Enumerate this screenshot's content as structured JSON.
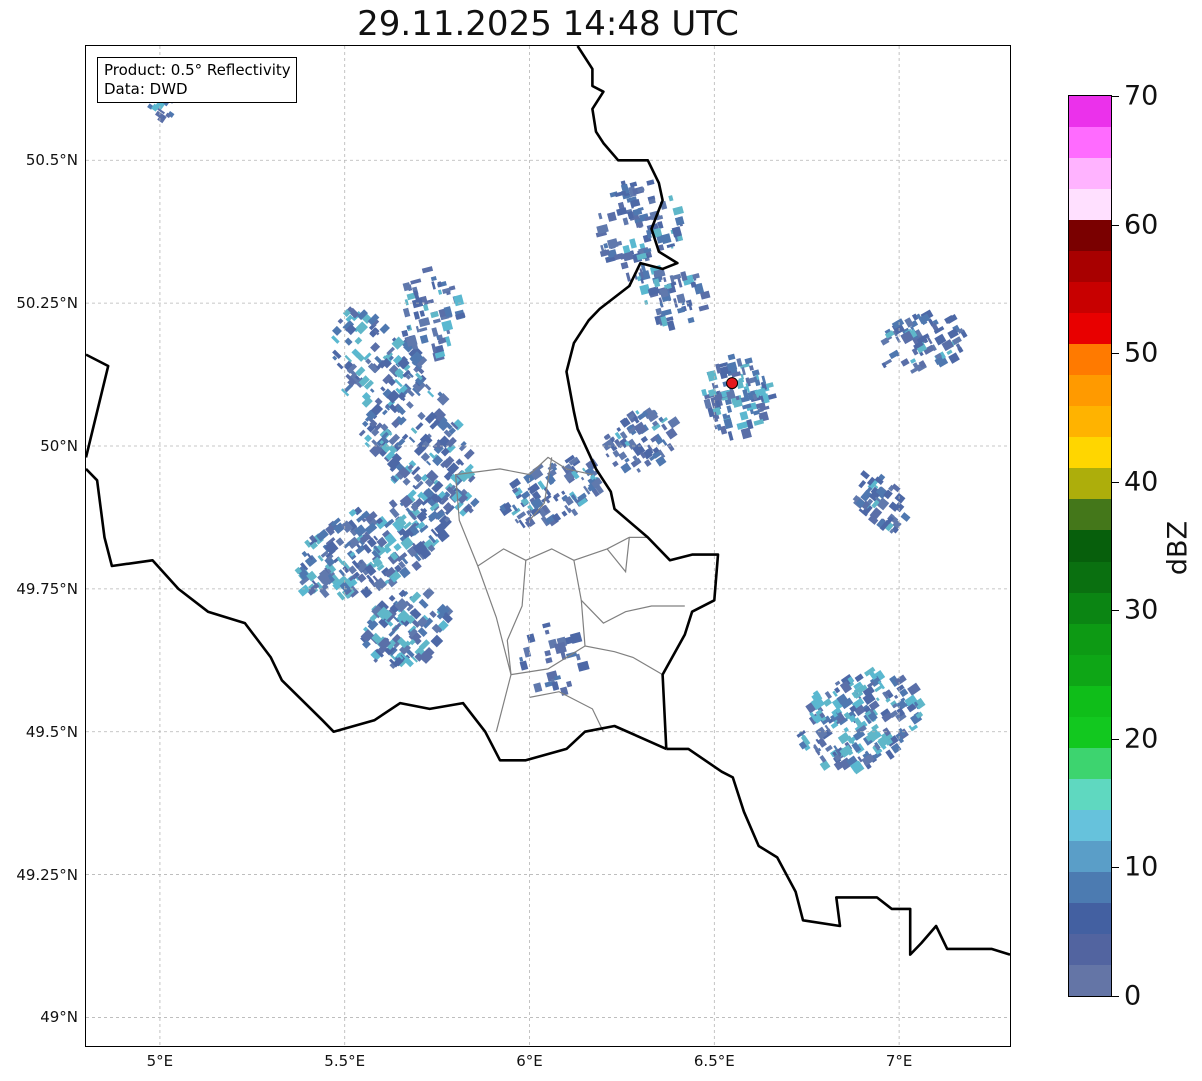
{
  "title": "29.11.2025 14:48 UTC",
  "info": {
    "line1": "Product: 0.5° Reflectivity",
    "line2": "Data: DWD"
  },
  "map": {
    "lon_range": [
      4.8,
      7.3
    ],
    "lat_range": [
      48.95,
      50.7
    ],
    "x_ticks": [
      {
        "value": 5.0,
        "label": "5°E"
      },
      {
        "value": 5.5,
        "label": "5.5°E"
      },
      {
        "value": 6.0,
        "label": "6°E"
      },
      {
        "value": 6.5,
        "label": "6.5°E"
      },
      {
        "value": 7.0,
        "label": "7°E"
      }
    ],
    "y_ticks": [
      {
        "value": 50.5,
        "label": "50.5°N"
      },
      {
        "value": 50.25,
        "label": "50.25°N"
      },
      {
        "value": 50.0,
        "label": "50°N"
      },
      {
        "value": 49.75,
        "label": "49.75°N"
      },
      {
        "value": 49.5,
        "label": "49.5°N"
      },
      {
        "value": 49.25,
        "label": "49.25°N"
      },
      {
        "value": 49.0,
        "label": "49°N"
      }
    ],
    "grid": true,
    "radar_site": {
      "lon": 6.548,
      "lat": 50.11,
      "color": "#e31a1c"
    },
    "precip_areas": [
      {
        "lon": 5.65,
        "lat": 50.05,
        "rlon": 0.12,
        "rlat": 0.21,
        "rot": -30,
        "n": 260,
        "intensity": 0.25
      },
      {
        "lon": 5.55,
        "lat": 49.82,
        "rlon": 0.22,
        "rlat": 0.07,
        "rot": -25,
        "n": 200,
        "intensity": 0.3
      },
      {
        "lon": 5.65,
        "lat": 49.68,
        "rlon": 0.12,
        "rlat": 0.06,
        "rot": -30,
        "n": 110,
        "intensity": 0.25
      },
      {
        "lon": 5.72,
        "lat": 50.24,
        "rlon": 0.08,
        "rlat": 0.08,
        "rot": 0,
        "n": 60,
        "intensity": 0.1
      },
      {
        "lon": 6.05,
        "lat": 49.92,
        "rlon": 0.14,
        "rlat": 0.05,
        "rot": -20,
        "n": 90,
        "intensity": 0.15
      },
      {
        "lon": 6.29,
        "lat": 50.38,
        "rlon": 0.12,
        "rlat": 0.09,
        "rot": 0,
        "n": 90,
        "intensity": 0.1
      },
      {
        "lon": 6.38,
        "lat": 50.26,
        "rlon": 0.09,
        "rlat": 0.05,
        "rot": 0,
        "n": 45,
        "intensity": 0.1
      },
      {
        "lon": 6.55,
        "lat": 50.09,
        "rlon": 0.09,
        "rlat": 0.07,
        "rot": 0,
        "n": 90,
        "intensity": 0.3
      },
      {
        "lon": 6.29,
        "lat": 50.01,
        "rlon": 0.1,
        "rlat": 0.05,
        "rot": -20,
        "n": 65,
        "intensity": 0.1
      },
      {
        "lon": 7.05,
        "lat": 50.18,
        "rlon": 0.12,
        "rlat": 0.05,
        "rot": -15,
        "n": 70,
        "intensity": 0.1
      },
      {
        "lon": 6.94,
        "lat": 49.9,
        "rlon": 0.06,
        "rlat": 0.06,
        "rot": -35,
        "n": 45,
        "intensity": 0.15
      },
      {
        "lon": 6.88,
        "lat": 49.52,
        "rlon": 0.17,
        "rlat": 0.08,
        "rot": -20,
        "n": 180,
        "intensity": 0.35
      },
      {
        "lon": 6.05,
        "lat": 49.63,
        "rlon": 0.08,
        "rlat": 0.06,
        "rot": 0,
        "n": 25,
        "intensity": 0.0
      },
      {
        "lon": 4.98,
        "lat": 50.62,
        "rlon": 0.06,
        "rlat": 0.06,
        "rot": -40,
        "n": 25,
        "intensity": 0.2
      }
    ],
    "borders_country": [
      [
        [
          6.13,
          50.7
        ],
        [
          6.17,
          50.66
        ],
        [
          6.17,
          50.63
        ],
        [
          6.2,
          50.62
        ],
        [
          6.17,
          50.59
        ],
        [
          6.18,
          50.55
        ],
        [
          6.2,
          50.53
        ],
        [
          6.24,
          50.5
        ],
        [
          6.32,
          50.5
        ],
        [
          6.35,
          50.46
        ],
        [
          6.36,
          50.43
        ],
        [
          6.33,
          50.38
        ],
        [
          6.35,
          50.34
        ],
        [
          6.4,
          50.32
        ],
        [
          6.36,
          50.31
        ],
        [
          6.3,
          50.32
        ],
        [
          6.27,
          50.28
        ],
        [
          6.19,
          50.24
        ],
        [
          6.16,
          50.22
        ],
        [
          6.12,
          50.18
        ],
        [
          6.1,
          50.13
        ],
        [
          6.12,
          50.06
        ],
        [
          6.13,
          50.03
        ],
        [
          6.18,
          49.96
        ],
        [
          6.22,
          49.92
        ],
        [
          6.23,
          49.89
        ],
        [
          6.32,
          49.84
        ],
        [
          6.38,
          49.8
        ],
        [
          6.44,
          49.81
        ],
        [
          6.51,
          49.81
        ],
        [
          6.5,
          49.73
        ],
        [
          6.44,
          49.71
        ],
        [
          6.42,
          49.67
        ],
        [
          6.36,
          49.6
        ],
        [
          6.37,
          49.47
        ]
      ],
      [
        [
          6.37,
          49.47
        ],
        [
          6.3,
          49.49
        ],
        [
          6.23,
          49.51
        ],
        [
          6.15,
          49.5
        ],
        [
          6.1,
          49.47
        ],
        [
          5.99,
          49.45
        ],
        [
          5.92,
          49.45
        ],
        [
          5.88,
          49.5
        ],
        [
          5.82,
          49.55
        ],
        [
          5.73,
          49.54
        ],
        [
          5.65,
          49.55
        ],
        [
          5.58,
          49.52
        ],
        [
          5.47,
          49.5
        ],
        [
          5.44,
          49.52
        ],
        [
          5.33,
          49.59
        ],
        [
          5.3,
          49.63
        ],
        [
          5.23,
          49.69
        ],
        [
          5.13,
          49.71
        ],
        [
          5.05,
          49.75
        ],
        [
          4.98,
          49.8
        ],
        [
          4.87,
          49.79
        ],
        [
          4.85,
          49.84
        ],
        [
          4.83,
          49.94
        ],
        [
          4.8,
          49.96
        ]
      ],
      [
        [
          4.8,
          49.98
        ],
        [
          4.83,
          50.06
        ],
        [
          4.86,
          50.14
        ],
        [
          4.8,
          50.16
        ]
      ],
      [
        [
          6.37,
          49.47
        ],
        [
          6.43,
          49.47
        ],
        [
          6.52,
          49.43
        ],
        [
          6.55,
          49.42
        ],
        [
          6.58,
          49.36
        ],
        [
          6.62,
          49.3
        ],
        [
          6.67,
          49.28
        ],
        [
          6.72,
          49.22
        ],
        [
          6.74,
          49.17
        ],
        [
          6.84,
          49.16
        ],
        [
          6.83,
          49.21
        ],
        [
          6.88,
          49.21
        ],
        [
          6.94,
          49.21
        ],
        [
          6.98,
          49.19
        ],
        [
          7.03,
          49.19
        ],
        [
          7.03,
          49.11
        ],
        [
          7.06,
          49.13
        ],
        [
          7.1,
          49.16
        ],
        [
          7.13,
          49.12
        ],
        [
          7.2,
          49.12
        ],
        [
          7.25,
          49.12
        ],
        [
          7.3,
          49.11
        ]
      ]
    ],
    "borders_internal": [
      [
        [
          5.91,
          49.5
        ],
        [
          5.95,
          49.6
        ],
        [
          5.91,
          49.7
        ],
        [
          5.86,
          49.79
        ],
        [
          5.81,
          49.87
        ],
        [
          5.8,
          49.95
        ],
        [
          5.92,
          49.96
        ],
        [
          6.0,
          49.95
        ],
        [
          6.05,
          49.98
        ],
        [
          6.1,
          49.96
        ],
        [
          6.17,
          49.95
        ]
      ],
      [
        [
          5.86,
          49.79
        ],
        [
          5.93,
          49.82
        ],
        [
          5.99,
          49.8
        ],
        [
          6.06,
          49.82
        ],
        [
          6.12,
          49.8
        ],
        [
          6.21,
          49.82
        ],
        [
          6.27,
          49.84
        ],
        [
          6.32,
          49.84
        ]
      ],
      [
        [
          5.99,
          49.8
        ],
        [
          5.98,
          49.72
        ],
        [
          5.94,
          49.66
        ],
        [
          5.95,
          49.6
        ]
      ],
      [
        [
          6.12,
          49.8
        ],
        [
          6.14,
          49.73
        ],
        [
          6.2,
          49.69
        ],
        [
          6.26,
          49.71
        ],
        [
          6.33,
          49.72
        ],
        [
          6.42,
          49.72
        ]
      ],
      [
        [
          6.14,
          49.73
        ],
        [
          6.15,
          49.65
        ],
        [
          6.23,
          49.64
        ],
        [
          6.28,
          49.63
        ],
        [
          6.36,
          49.6
        ]
      ],
      [
        [
          5.95,
          49.6
        ],
        [
          6.05,
          49.61
        ],
        [
          6.15,
          49.65
        ]
      ],
      [
        [
          6.0,
          49.56
        ],
        [
          6.08,
          49.57
        ],
        [
          6.17,
          49.54
        ],
        [
          6.2,
          49.5
        ]
      ],
      [
        [
          6.06,
          49.98
        ],
        [
          6.04,
          49.9
        ],
        [
          6.0,
          49.87
        ]
      ],
      [
        [
          6.21,
          49.82
        ],
        [
          6.26,
          49.78
        ],
        [
          6.27,
          49.84
        ]
      ]
    ]
  },
  "colorbar": {
    "label": "dBZ",
    "min": 0,
    "max": 70,
    "ticks": [
      0,
      10,
      20,
      30,
      40,
      50,
      60,
      70
    ],
    "colors": [
      "#6475a6",
      "#5264a0",
      "#4360a1",
      "#4c7bb1",
      "#5a9ec8",
      "#66c2dc",
      "#5fd8c0",
      "#3dd46f",
      "#12c81f",
      "#0fbe19",
      "#0ea616",
      "#0d9a14",
      "#0b8513",
      "#0a7010",
      "#075f0c",
      "#44771a",
      "#adae0b",
      "#ffd600",
      "#ffb300",
      "#ff9a00",
      "#ff7a00",
      "#e80000",
      "#c80000",
      "#a80000",
      "#7a0000",
      "#ffe0ff",
      "#ffb3ff",
      "#ff6bff",
      "#eb31eb"
    ]
  }
}
